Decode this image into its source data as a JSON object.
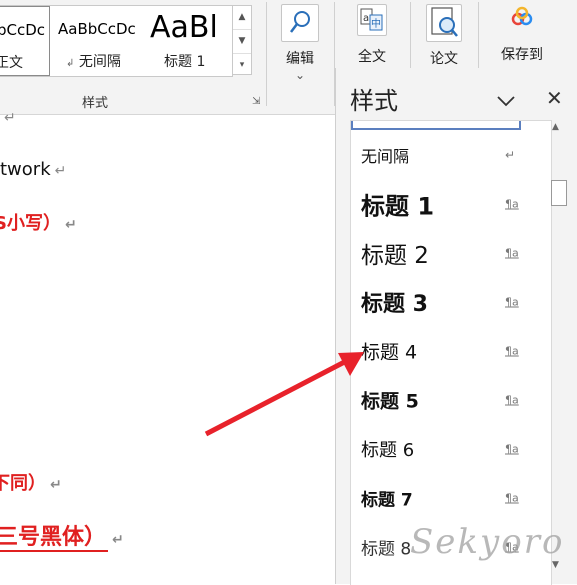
{
  "ribbon": {
    "styles_gallery": [
      {
        "sample": "bCcDc",
        "name": "正文"
      },
      {
        "sample": "AaBbCcDc",
        "name": "无间隔",
        "mark": "↲"
      },
      {
        "sample": "AaBl",
        "name": "标题 1"
      }
    ],
    "styles_group_label": "样式",
    "launcher_icon": "dialog-launcher-icon",
    "tools": [
      {
        "label": "编辑",
        "icon": "search-icon"
      },
      {
        "label": "全文",
        "icon": "translate-icon"
      },
      {
        "label": "论文",
        "icon": "paper-check-icon"
      },
      {
        "label": "保存到",
        "icon": "cloud-save-icon"
      }
    ],
    "more_arrow": "⌄"
  },
  "document": {
    "lines": [
      {
        "text": "",
        "mark": "↵"
      },
      {
        "text": "twork",
        "mark": "↵"
      },
      {
        "text": "S小写）",
        "mark": "↵"
      },
      {
        "text": "下同）",
        "mark": "↵"
      },
      {
        "text": "三号黑体）",
        "mark": "↵"
      }
    ],
    "emphasis_color": "#e02020"
  },
  "styles_pane": {
    "title": "样式",
    "collapse_icon": "chevron-down-icon",
    "close_icon": "close-icon",
    "items": [
      {
        "label": "无间隔",
        "mark": "↵"
      },
      {
        "label": "标题 1",
        "mark": "¶a"
      },
      {
        "label": "标题 2",
        "mark": "¶a"
      },
      {
        "label": "标题 3",
        "mark": "¶a"
      },
      {
        "label": "标题 4",
        "mark": "¶a"
      },
      {
        "label": "标题 5",
        "mark": "¶a"
      },
      {
        "label": "标题 6",
        "mark": "¶a"
      },
      {
        "label": "标题 7",
        "mark": "¶a"
      },
      {
        "label": "标题 8",
        "mark": "¶a"
      }
    ]
  },
  "annotation": {
    "arrow_color": "#e8222b",
    "target": "标题 4"
  },
  "watermark": "Sekyoro"
}
